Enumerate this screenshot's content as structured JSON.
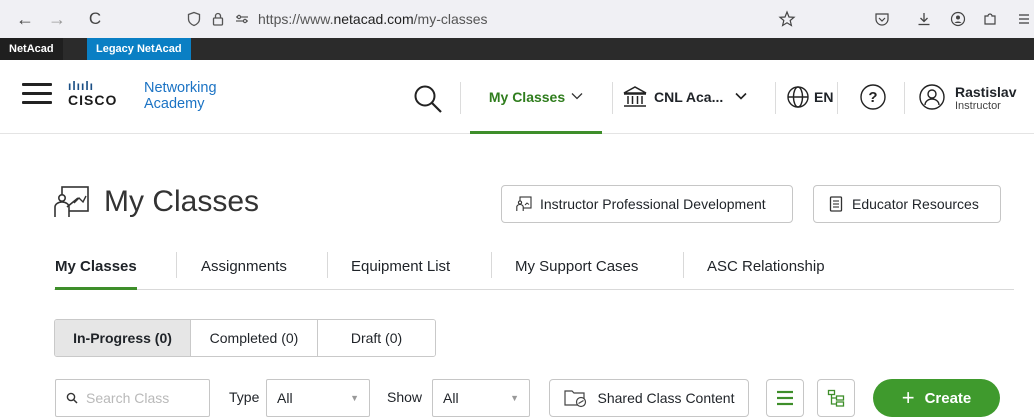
{
  "browser": {
    "back_glyph": "←",
    "forward_glyph": "→",
    "reload_glyph": "C",
    "url_prefix": "https://www.",
    "url_host": "netacad.com",
    "url_path": "/my-classes"
  },
  "strip": {
    "tabs": [
      {
        "label": "NetAcad"
      },
      {
        "label": "Legacy NetAcad"
      }
    ]
  },
  "header": {
    "logo_bars": "ılıılı",
    "logo_cisco": "CISCO",
    "logo_line1": "Networking",
    "logo_line2": "Academy",
    "nav_my_classes": "My Classes",
    "nav_academy": "CNL Aca...",
    "language": "EN",
    "help_glyph": "?",
    "user_name": "Rastislav",
    "user_role": "Instructor"
  },
  "page": {
    "title": "My Classes",
    "btn_prof_dev": "Instructor Professional Development",
    "btn_edu_resources": "Educator Resources"
  },
  "tabs": [
    {
      "label": "My Classes",
      "active": true
    },
    {
      "label": "Assignments"
    },
    {
      "label": "Equipment List"
    },
    {
      "label": "My Support Cases"
    },
    {
      "label": "ASC Relationship"
    }
  ],
  "segments": [
    {
      "label": "In-Progress (0)",
      "active": true
    },
    {
      "label": "Completed (0)"
    },
    {
      "label": "Draft (0)"
    }
  ],
  "filters": {
    "search_placeholder": "Search Class",
    "type_label": "Type",
    "type_value": "All",
    "show_label": "Show",
    "show_value": "All",
    "shared_content_label": "Shared Class Content",
    "create_label": "Create",
    "create_glyph": "+"
  },
  "colors": {
    "accent_green": "#3e8e2a",
    "create_green": "#3f9a2d",
    "legacy_blue": "#0a7fc4",
    "logo_blue": "#1b73c4"
  }
}
